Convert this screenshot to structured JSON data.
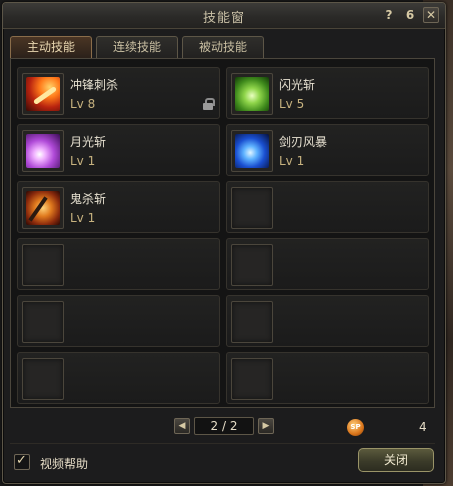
{
  "window": {
    "title": "技能窗"
  },
  "titlebar_icons": [
    {
      "name": "help-icon",
      "glyph": "?"
    },
    {
      "name": "lock-toggle-icon",
      "glyph": "6"
    },
    {
      "name": "close-icon",
      "glyph": "✕"
    }
  ],
  "tabs": [
    {
      "label": "主动技能",
      "active": true
    },
    {
      "label": "连续技能",
      "active": false
    },
    {
      "label": "被动技能",
      "active": false
    }
  ],
  "skills": [
    {
      "name": "冲锋刺杀",
      "level": "Lv 8",
      "icon": "charge-stab-icon",
      "art": "red",
      "locked": true
    },
    {
      "name": "闪光斩",
      "level": "Lv 5",
      "icon": "flash-slash-icon",
      "art": "green",
      "locked": false
    },
    {
      "name": "月光斩",
      "level": "Lv 1",
      "icon": "moonlight-slash-icon",
      "art": "purple",
      "locked": false
    },
    {
      "name": "剑刃风暴",
      "level": "Lv 1",
      "icon": "blade-storm-icon",
      "art": "blue",
      "locked": false
    },
    {
      "name": "鬼杀斩",
      "level": "Lv 1",
      "icon": "ghost-slash-icon",
      "art": "orange",
      "locked": false
    }
  ],
  "empty_slot_count": 7,
  "pager": {
    "text": "2 / 2",
    "prev_glyph": "◀",
    "next_glyph": "▶"
  },
  "sp": {
    "badge": "SP",
    "count": "4"
  },
  "footer": {
    "video_help_label": "视频帮助",
    "video_help_checked": true,
    "check_glyph": "✓",
    "close_label": "关闭"
  },
  "colors": {
    "active_tab": "#4a3524",
    "level_text": "#c7b27f",
    "close_button": "#5b5a3d"
  }
}
